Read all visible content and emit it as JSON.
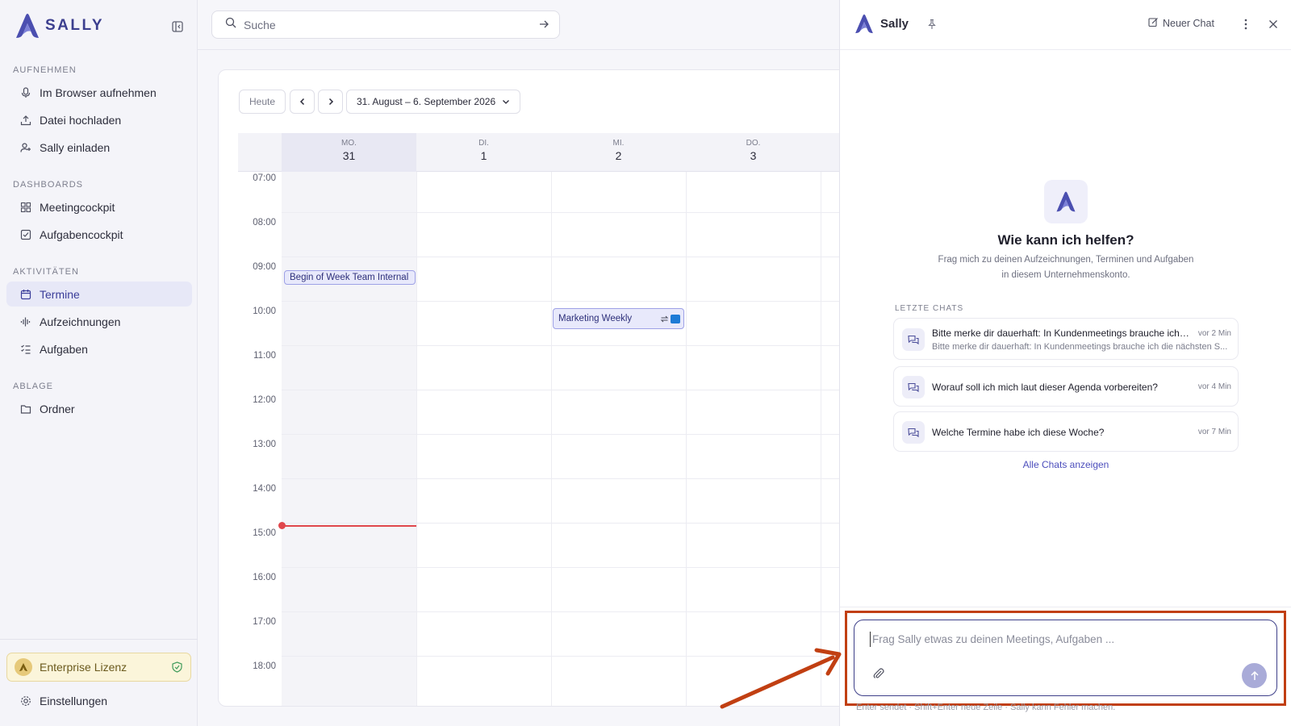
{
  "brand": {
    "name": "SALLY",
    "accent": "#3b3e9a"
  },
  "sidebar": {
    "sections": [
      {
        "label": "AUFNEHMEN",
        "items": [
          {
            "label": "Im Browser aufnehmen",
            "icon": "microphone-icon"
          },
          {
            "label": "Datei hochladen",
            "icon": "upload-icon"
          },
          {
            "label": "Sally einladen",
            "icon": "user-plus-icon"
          }
        ]
      },
      {
        "label": "DASHBOARDS",
        "items": [
          {
            "label": "Meetingcockpit",
            "icon": "grid-icon"
          },
          {
            "label": "Aufgabencockpit",
            "icon": "checkbox-icon"
          }
        ]
      },
      {
        "label": "AKTIVITÄTEN",
        "items": [
          {
            "label": "Termine",
            "icon": "calendar-icon",
            "active": true
          },
          {
            "label": "Aufzeichnungen",
            "icon": "waveform-icon"
          },
          {
            "label": "Aufgaben",
            "icon": "tasklist-icon"
          }
        ]
      },
      {
        "label": "ABLAGE",
        "items": [
          {
            "label": "Ordner",
            "icon": "folder-icon"
          }
        ]
      }
    ],
    "license": "Enterprise Lizenz",
    "settings": "Einstellungen"
  },
  "search": {
    "placeholder": "Suche"
  },
  "calendar": {
    "today_label": "Heute",
    "range": "31. August – 6. September 2026",
    "days": [
      {
        "name": "MO.",
        "date": "31"
      },
      {
        "name": "DI.",
        "date": "1"
      },
      {
        "name": "MI.",
        "date": "2"
      },
      {
        "name": "DO.",
        "date": "3"
      }
    ],
    "hours": [
      "07:00",
      "08:00",
      "09:00",
      "10:00",
      "11:00",
      "12:00",
      "13:00",
      "14:00",
      "15:00",
      "16:00",
      "17:00",
      "18:00"
    ],
    "events": [
      {
        "title": "Begin of Week Team Internal",
        "day": "MO.",
        "start": "09:00"
      },
      {
        "title": "Marketing Weekly",
        "day": "MI.",
        "start": "10:00"
      }
    ]
  },
  "chat": {
    "title": "Sally",
    "new_chat": "Neuer Chat",
    "hero_title": "Wie kann ich helfen?",
    "hero_sub": "Frag mich zu deinen Aufzeichnungen, Terminen und Aufgaben in diesem Unternehmenskonto.",
    "recent_label": "LETZTE CHATS",
    "recent": [
      {
        "title": "Bitte merke dir dauerhaft: In Kundenmeetings brauche ich ...",
        "snippet": "Bitte merke dir dauerhaft: In Kundenmeetings brauche ich die nächsten S...",
        "time": "vor 2 Min"
      },
      {
        "title": "Worauf soll ich mich laut dieser Agenda vorbereiten?",
        "snippet": "",
        "time": "vor 4 Min"
      },
      {
        "title": "Welche Termine habe ich diese Woche?",
        "snippet": "",
        "time": "vor 7 Min"
      }
    ],
    "all_chats": "Alle Chats anzeigen",
    "composer_placeholder": "Frag Sally etwas zu deinen Meetings, Aufgaben ...",
    "hint": "Enter sendet · Shift+Enter neue Zeile · Sally kann Fehler machen.",
    "annotation_color": "#c13f12"
  }
}
